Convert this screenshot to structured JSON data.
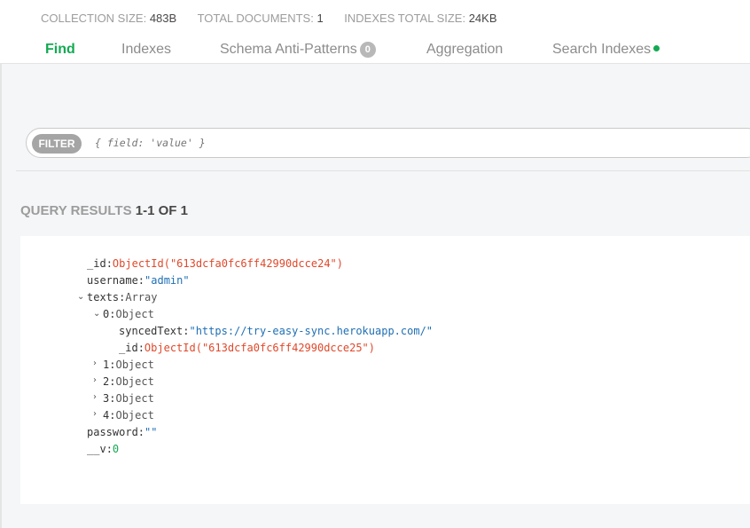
{
  "stats": {
    "collection_size_label": "COLLECTION SIZE:",
    "collection_size_value": "483B",
    "total_documents_label": "TOTAL DOCUMENTS:",
    "total_documents_value": "1",
    "indexes_total_size_label": "INDEXES TOTAL SIZE:",
    "indexes_total_size_value": "24KB"
  },
  "tabs": [
    {
      "label": "Find",
      "active": true
    },
    {
      "label": "Indexes"
    },
    {
      "label": "Schema Anti-Patterns",
      "badge": "0"
    },
    {
      "label": "Aggregation"
    },
    {
      "label": "Search Indexes",
      "status_dot_color": "#13aa52"
    }
  ],
  "filter": {
    "label": "FILTER",
    "placeholder": "{ field: 'value' }"
  },
  "results": {
    "label": "QUERY RESULTS",
    "count": "1-1 OF 1"
  },
  "document": {
    "id_key": "_id",
    "id_value": "ObjectId(\"613dcfa0fc6ff42990dcce24\")",
    "username_key": "username",
    "username_value": "\"admin\"",
    "texts_key": "texts",
    "texts_type": "Array",
    "items": [
      {
        "index": "0",
        "type": "Object",
        "expanded": true,
        "synced_key": "syncedText",
        "synced_value": "\"https://try-easy-sync.herokuapp.com/\"",
        "id_key": "_id",
        "id_value": "ObjectId(\"613dcfa0fc6ff42990dcce25\")"
      },
      {
        "index": "1",
        "type": "Object"
      },
      {
        "index": "2",
        "type": "Object"
      },
      {
        "index": "3",
        "type": "Object"
      },
      {
        "index": "4",
        "type": "Object"
      }
    ],
    "password_key": "password",
    "password_value": "\"\"",
    "v_key": "__v",
    "v_value": "0"
  },
  "colors": {
    "accent_green": "#13aa52",
    "object_id": "#e0482a",
    "string": "#1f6fb4"
  }
}
